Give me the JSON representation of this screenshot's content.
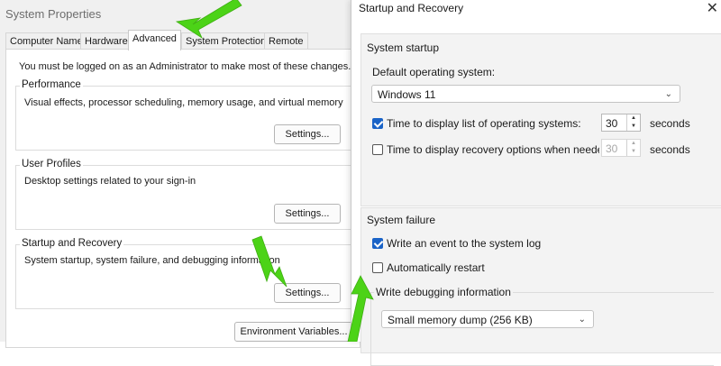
{
  "system_properties": {
    "title": "System Properties",
    "tabs": [
      {
        "label": "Computer Name",
        "active": false
      },
      {
        "label": "Hardware",
        "active": false
      },
      {
        "label": "Advanced",
        "active": true
      },
      {
        "label": "System Protection",
        "active": false
      },
      {
        "label": "Remote",
        "active": false
      }
    ],
    "admin_notice": "You must be logged on as an Administrator to make most of these changes.",
    "performance": {
      "heading": "Performance",
      "description": "Visual effects, processor scheduling, memory usage, and virtual memory",
      "button": "Settings..."
    },
    "user_profiles": {
      "heading": "User Profiles",
      "description": "Desktop settings related to your sign-in",
      "button": "Settings..."
    },
    "startup_recovery": {
      "heading": "Startup and Recovery",
      "description": "System startup, system failure, and debugging information",
      "button": "Settings..."
    },
    "env_button": "Environment Variables..."
  },
  "startup_recovery_dialog": {
    "title": "Startup and Recovery",
    "close_glyph": "✕",
    "system_startup": {
      "heading": "System startup",
      "default_os_label": "Default operating system:",
      "default_os_value": "Windows 11",
      "display_list": {
        "label": "Time to display list of operating systems:",
        "checked": true,
        "value": "30",
        "unit": "seconds"
      },
      "display_recovery": {
        "label": "Time to display recovery options when needed:",
        "checked": false,
        "value": "30",
        "unit": "seconds"
      }
    },
    "system_failure": {
      "heading": "System failure",
      "write_event": {
        "label": "Write an event to the system log",
        "checked": true
      },
      "auto_restart": {
        "label": "Automatically restart",
        "checked": false
      },
      "debug_heading": "Write debugging information",
      "debug_value": "Small memory dump (256 KB)"
    }
  },
  "colors": {
    "annotation_arrow": "#4cd317",
    "checkbox_accent": "#1a63c7"
  },
  "icons": {
    "chevron": "chevron-down-icon",
    "close": "close-icon",
    "arrow": "green-annotation-arrow"
  }
}
